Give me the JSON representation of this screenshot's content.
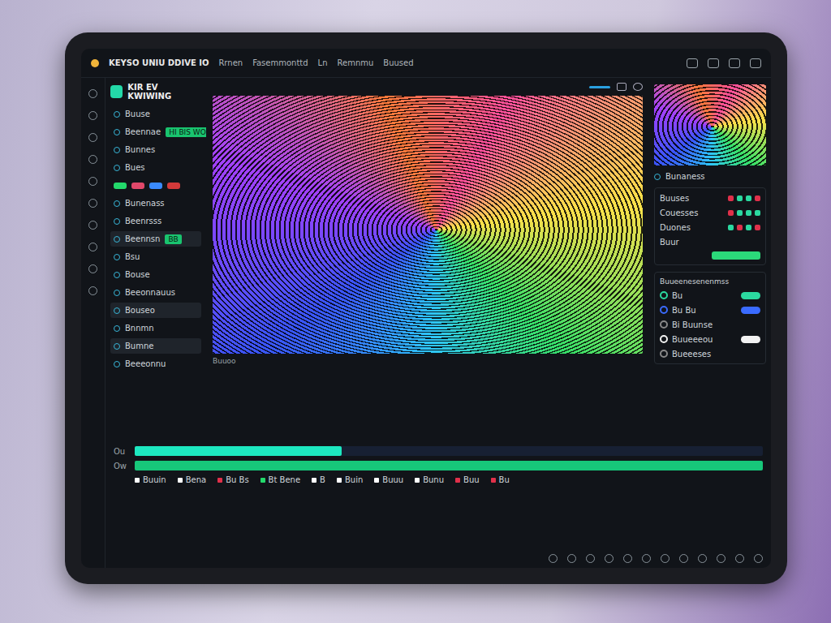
{
  "window": {
    "title": "KEYSO UNIU DDIVE IO"
  },
  "menu": [
    "Rrnen",
    "Fasemmonttd",
    "Ln",
    "Remnmu",
    "Buused"
  ],
  "project": {
    "title": "KIR EV KWIWING"
  },
  "sidebar": {
    "items": [
      {
        "kind": "item",
        "label": "Buuse",
        "selected": false
      },
      {
        "kind": "badge",
        "label": "Beennae",
        "badge": "HI BIS WO",
        "selected": false
      },
      {
        "kind": "item",
        "label": "Bunnes",
        "selected": false
      },
      {
        "kind": "item",
        "label": "Bues",
        "selected": false
      },
      {
        "kind": "swatches",
        "colors": [
          "#23d96b",
          "#e0486a",
          "#3a8bff",
          "#d23a3a"
        ],
        "selected": false
      },
      {
        "kind": "item",
        "label": "Bunenass",
        "selected": false
      },
      {
        "kind": "item",
        "label": "Beenrsss",
        "selected": false
      },
      {
        "kind": "badge",
        "label": "Beennsn",
        "badge": "BB",
        "selected": true
      },
      {
        "kind": "item",
        "label": "Bsu",
        "selected": false
      },
      {
        "kind": "item",
        "label": "Bouse",
        "selected": false
      },
      {
        "kind": "item",
        "label": "Beeonnauus",
        "selected": false
      },
      {
        "kind": "item",
        "label": "Bouseo",
        "selected": true
      },
      {
        "kind": "item",
        "label": "Bnnmn",
        "selected": false
      },
      {
        "kind": "item",
        "label": "Bumne",
        "selected": true
      },
      {
        "kind": "item",
        "label": "Beeeonnu",
        "selected": false
      }
    ]
  },
  "preview": {
    "caption": "Buuoo"
  },
  "inspector": {
    "heading": "Bunaness",
    "properties": [
      {
        "label": "Buuses",
        "colors": [
          "#e0304a",
          "#2bd9a0",
          "#2bd9a0",
          "#e0304a"
        ]
      },
      {
        "label": "Couesses",
        "colors": [
          "#e0304a",
          "#2bd9a0",
          "#2bd9a0",
          "#2bd9a0"
        ]
      },
      {
        "label": "Duones",
        "colors": [
          "#2bd9a0",
          "#e0304a",
          "#2bd9a0",
          "#e0304a"
        ]
      },
      {
        "label": "Buur",
        "colors": []
      }
    ]
  },
  "effects": {
    "title": "Buueenesenenmss",
    "rows": [
      {
        "kind": "toggle",
        "label": "Bu",
        "on": true,
        "color": "#2bd9a0"
      },
      {
        "kind": "toggle",
        "label": "Bu Bu",
        "on": true,
        "color": "#3a6bff"
      },
      {
        "kind": "plain",
        "label": "Bi Buunse",
        "on": false,
        "color": "#888888"
      },
      {
        "kind": "toggle",
        "label": "Buueeeou",
        "on": true,
        "color": "#f2f2f2"
      },
      {
        "kind": "plain",
        "label": "Bueeeses",
        "on": false,
        "color": "#888888"
      }
    ]
  },
  "timeline": {
    "tracks": [
      {
        "label": "Ou",
        "level": 0.33,
        "color": "#1de8c0"
      },
      {
        "label": "Ow",
        "level": 1.0,
        "color": "#17c77a"
      }
    ],
    "markers": [
      {
        "label": "Buuin",
        "color": "#ffffff"
      },
      {
        "label": "Bena",
        "color": "#ffffff"
      },
      {
        "label": "Bu Bs",
        "color": "#e0304a"
      },
      {
        "label": "Bt Bene",
        "color": "#23d96b"
      },
      {
        "label": "B",
        "color": "#ffffff"
      },
      {
        "label": "Buin",
        "color": "#ffffff"
      },
      {
        "label": "Buuu",
        "color": "#ffffff"
      },
      {
        "label": "Bunu",
        "color": "#ffffff"
      },
      {
        "label": "Buu",
        "color": "#e0304a"
      },
      {
        "label": "Bu",
        "color": "#e0304a"
      }
    ]
  }
}
